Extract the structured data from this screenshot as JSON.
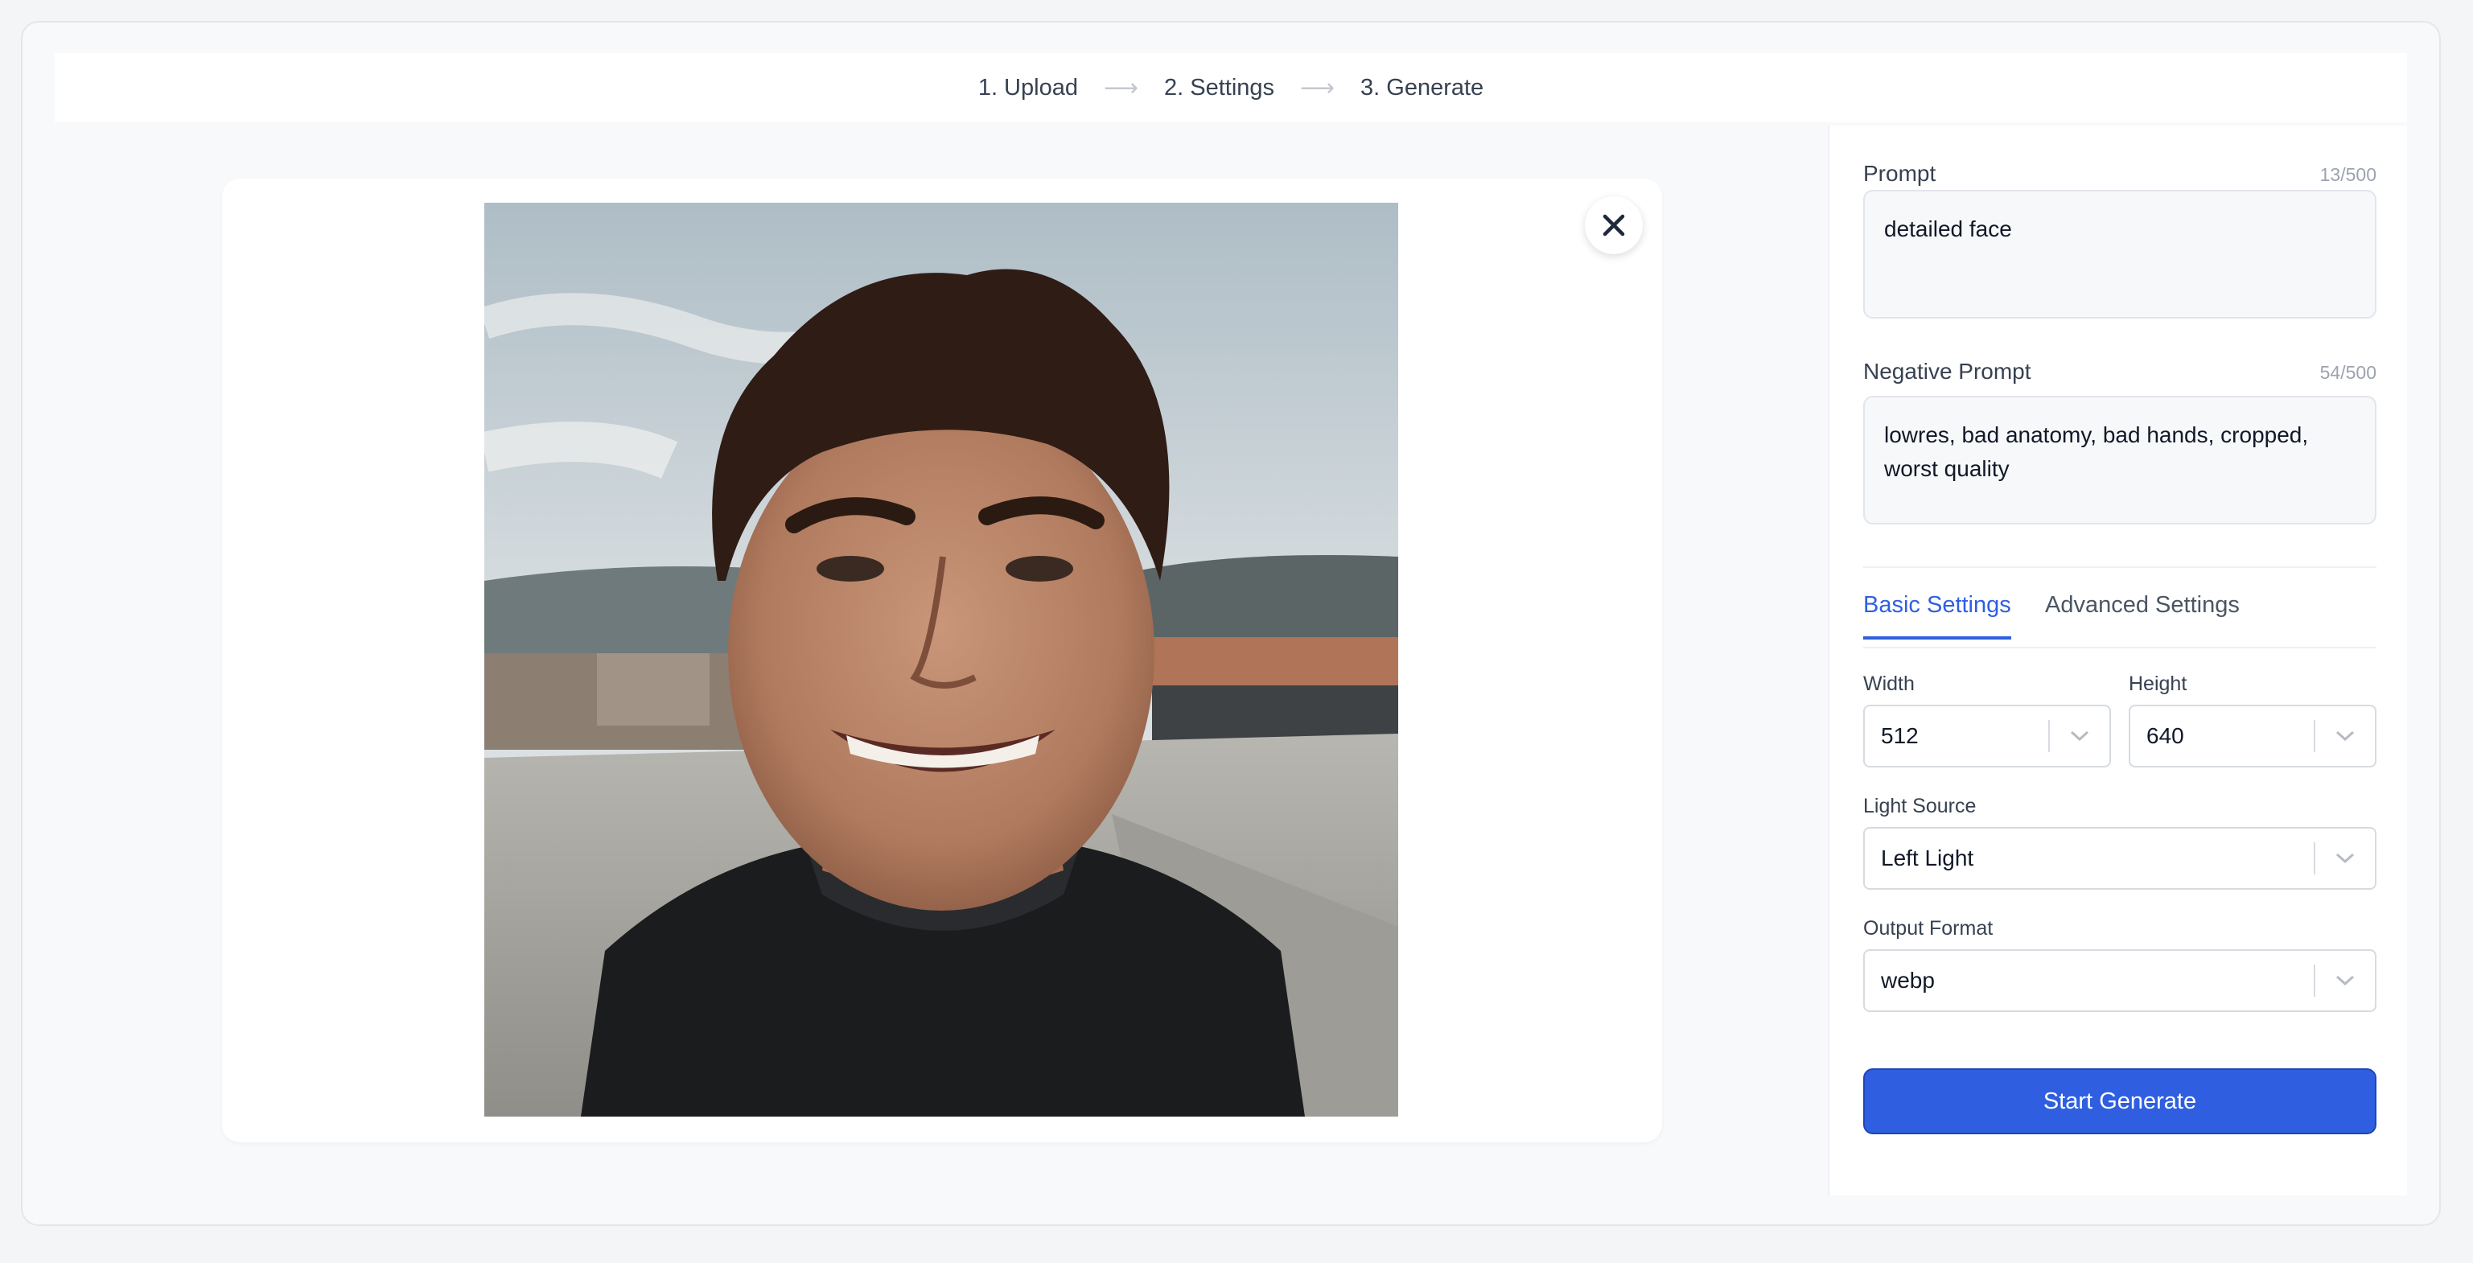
{
  "steps": [
    {
      "label": "1. Upload"
    },
    {
      "label": "2. Settings"
    },
    {
      "label": "3. Generate"
    }
  ],
  "icons": {
    "step_arrow": "arrow-right-icon",
    "close": "close-icon",
    "dropdown": "chevron-down-icon"
  },
  "preview": {
    "subject": "smiling-man-portrait"
  },
  "prompt": {
    "label": "Prompt",
    "counter": "13/500",
    "value": "detailed face"
  },
  "negative_prompt": {
    "label": "Negative Prompt",
    "counter": "54/500",
    "value": "lowres, bad anatomy, bad hands, cropped, worst quality"
  },
  "tabs": [
    {
      "label": "Basic Settings",
      "active": true
    },
    {
      "label": "Advanced Settings",
      "active": false
    }
  ],
  "settings": {
    "width": {
      "label": "Width",
      "value": "512"
    },
    "height": {
      "label": "Height",
      "value": "640"
    },
    "light_source": {
      "label": "Light Source",
      "value": "Left Light"
    },
    "output_format": {
      "label": "Output Format",
      "value": "webp"
    }
  },
  "generate_button": {
    "label": "Start Generate"
  },
  "colors": {
    "accent": "#2f5fe0",
    "page_bg": "#f8f9fb"
  }
}
